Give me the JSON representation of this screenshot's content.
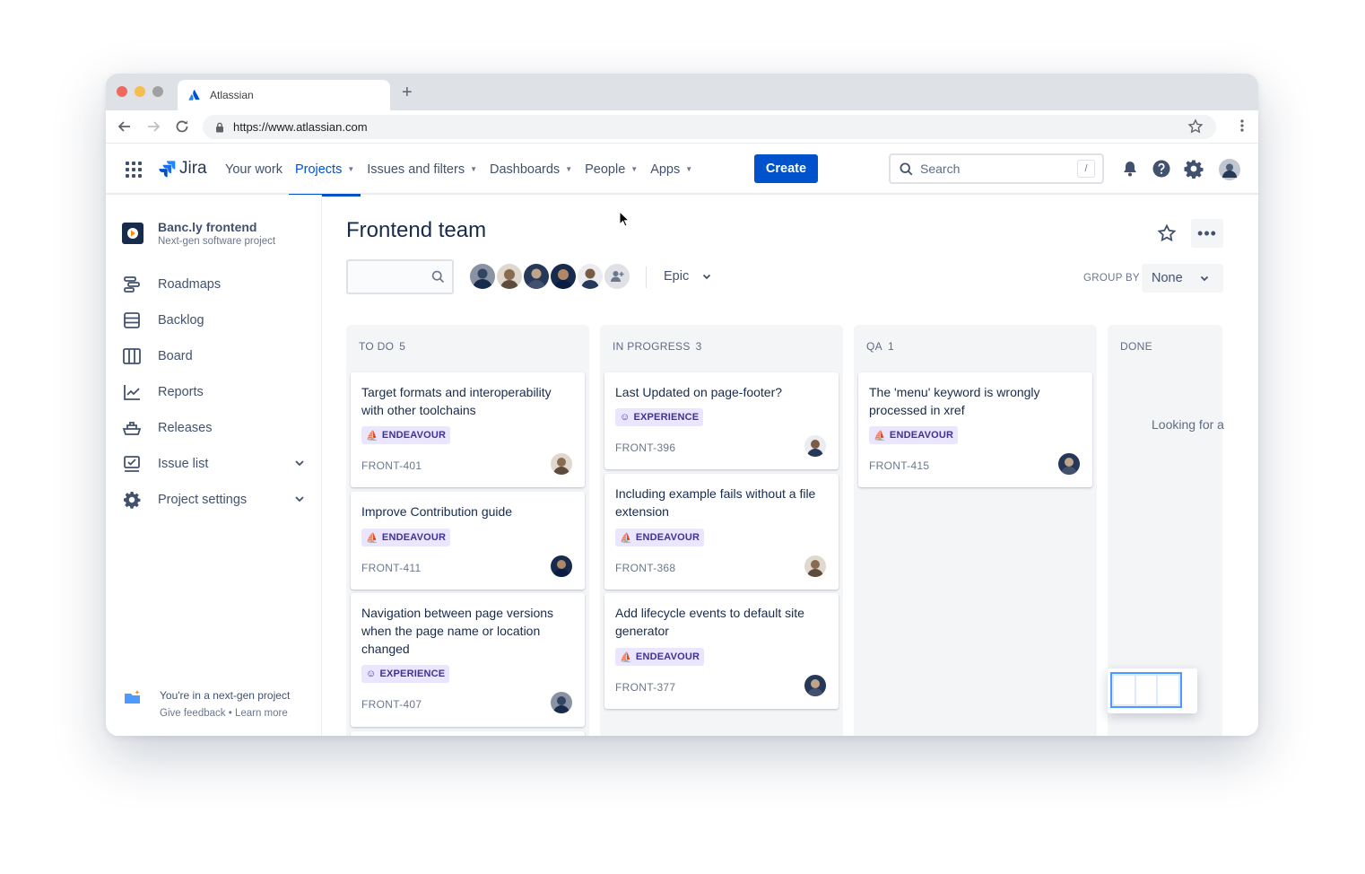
{
  "browser": {
    "tab_title": "Atlassian",
    "url": "https://www.atlassian.com",
    "new_tab": "+"
  },
  "nav": {
    "product": "Jira",
    "items": [
      {
        "label": "Your work",
        "caret": false,
        "active": false
      },
      {
        "label": "Projects",
        "caret": true,
        "active": true
      },
      {
        "label": "Issues and filters",
        "caret": true,
        "active": false
      },
      {
        "label": "Dashboards",
        "caret": true,
        "active": false
      },
      {
        "label": "People",
        "caret": true,
        "active": false
      },
      {
        "label": "Apps",
        "caret": true,
        "active": false
      }
    ],
    "create_label": "Create",
    "search_placeholder": "Search",
    "search_shortcut": "/"
  },
  "sidebar": {
    "project_name": "Banc.ly frontend",
    "project_type": "Next-gen software project",
    "items": [
      {
        "label": "Roadmaps",
        "icon": "roadmap-icon"
      },
      {
        "label": "Backlog",
        "icon": "backlog-icon"
      },
      {
        "label": "Board",
        "icon": "board-icon"
      },
      {
        "label": "Reports",
        "icon": "reports-icon"
      },
      {
        "label": "Releases",
        "icon": "releases-icon"
      },
      {
        "label": "Issue list",
        "icon": "issue-list-icon",
        "expandable": true
      },
      {
        "label": "Project settings",
        "icon": "settings-icon",
        "expandable": true
      }
    ],
    "footer_title": "You're in a next-gen project",
    "footer_feedback": "Give feedback",
    "footer_sep": "•",
    "footer_learn": "Learn more"
  },
  "board": {
    "title": "Frontend team",
    "epic_filter": "Epic",
    "group_by_label": "GROUP BY",
    "group_by_value": "None",
    "more_label": "•••",
    "columns": [
      {
        "name": "TO DO",
        "count": "5",
        "cards": [
          {
            "title": "Target formats and interoperability with other toolchains",
            "label": "ENDEAVOUR",
            "key": "FRONT-401"
          },
          {
            "title": "Improve Contribution guide",
            "label": "ENDEAVOUR",
            "key": "FRONT-411"
          },
          {
            "title": "Navigation between page versions when the page name or location changed",
            "label": "EXPERIENCE",
            "key": "FRONT-407"
          }
        ]
      },
      {
        "name": "IN PROGRESS",
        "count": "3",
        "cards": [
          {
            "title": "Last Updated on page-footer?",
            "label": "EXPERIENCE",
            "key": "FRONT-396"
          },
          {
            "title": "Including example fails without a file extension",
            "label": "ENDEAVOUR",
            "key": "FRONT-368"
          },
          {
            "title": "Add lifecycle events to default site generator",
            "label": "ENDEAVOUR",
            "key": "FRONT-377"
          }
        ]
      },
      {
        "name": "QA",
        "count": "1",
        "cards": [
          {
            "title": "The 'menu' keyword is wrongly processed in xref",
            "label": "ENDEAVOUR",
            "key": "FRONT-415"
          }
        ]
      },
      {
        "name": "DONE",
        "count": "",
        "cards": []
      }
    ],
    "done_hint": "Looking for a"
  },
  "colors": {
    "brand": "#0052CC",
    "label_bg": "#EAE6FF",
    "label_text": "#403294",
    "column_bg": "#F4F5F7",
    "traffic_red": "#EE6A5F",
    "traffic_yellow": "#F5BD4F",
    "traffic_gray": "#A0A0A0"
  }
}
